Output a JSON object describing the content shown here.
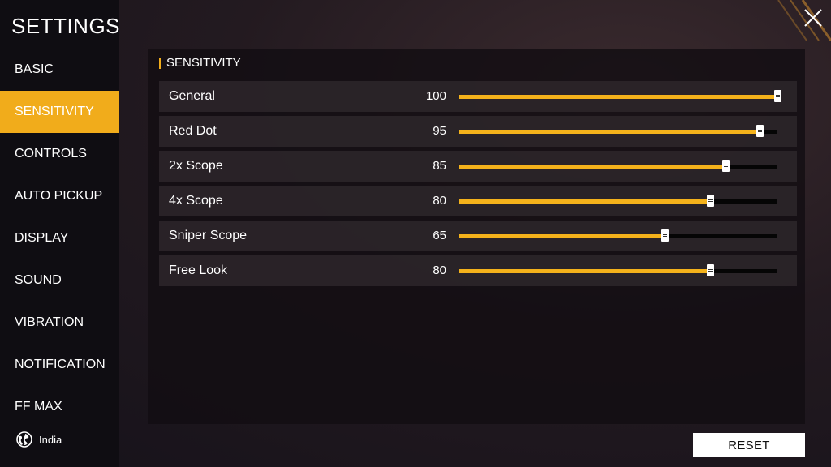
{
  "sidebar": {
    "title": "SETTINGS",
    "items": [
      {
        "label": "BASIC",
        "active": false
      },
      {
        "label": "SENSITIVITY",
        "active": true
      },
      {
        "label": "CONTROLS",
        "active": false
      },
      {
        "label": "AUTO PICKUP",
        "active": false
      },
      {
        "label": "DISPLAY",
        "active": false
      },
      {
        "label": "SOUND",
        "active": false
      },
      {
        "label": "VIBRATION",
        "active": false
      },
      {
        "label": "NOTIFICATION",
        "active": false
      },
      {
        "label": "FF MAX",
        "active": false
      }
    ],
    "region": {
      "label": "India",
      "icon": "globe-icon"
    }
  },
  "panel": {
    "title": "SENSITIVITY",
    "rows": [
      {
        "label": "General",
        "value": "100",
        "fraction": 1.0
      },
      {
        "label": "Red Dot",
        "value": "95",
        "fraction": 0.943
      },
      {
        "label": "2x Scope",
        "value": "85",
        "fraction": 0.838
      },
      {
        "label": "4x Scope",
        "value": "80",
        "fraction": 0.788
      },
      {
        "label": "Sniper Scope",
        "value": "65",
        "fraction": 0.646
      },
      {
        "label": "Free Look",
        "value": "80",
        "fraction": 0.788
      }
    ]
  },
  "actions": {
    "reset_label": "RESET",
    "close_icon": "close-icon"
  },
  "colors": {
    "accent": "#f1ac1b",
    "slider_fill": "#f4b21b",
    "sidebar_bg": "#0f0d12"
  }
}
